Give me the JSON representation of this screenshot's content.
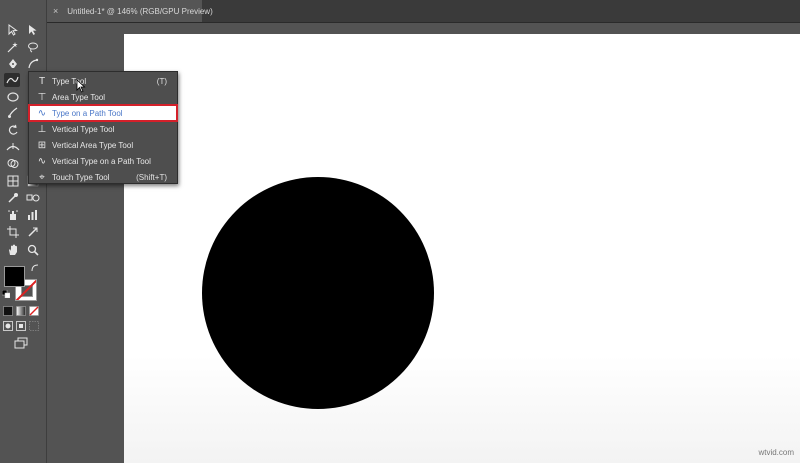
{
  "tab": {
    "close_glyph": "×",
    "title": "Untitled-1* @ 146% (RGB/GPU Preview)"
  },
  "toolbar": {
    "tools": [
      {
        "name": "selection-tool",
        "icon": "arrow-icon"
      },
      {
        "name": "direct-selection-tool",
        "icon": "hollow-arrow-icon"
      },
      {
        "name": "magic-wand-tool",
        "icon": "wand-icon"
      },
      {
        "name": "lasso-tool",
        "icon": "lasso-icon"
      },
      {
        "name": "pen-tool",
        "icon": "pen-icon"
      },
      {
        "name": "curvature-tool",
        "icon": "curvature-icon"
      },
      {
        "name": "type-tool",
        "icon": "type-path-icon"
      },
      {
        "name": "line-tool",
        "icon": "line-icon"
      },
      {
        "name": "ellipse-tool",
        "icon": "ellipse-icon"
      },
      {
        "name": "paintbrush-tool",
        "icon": "brush-icon"
      },
      {
        "name": "shaper-tool",
        "icon": "shaper-icon"
      },
      {
        "name": "eraser-tool",
        "icon": "eraser-icon"
      },
      {
        "name": "rotate-tool",
        "icon": "rotate-icon"
      },
      {
        "name": "scale-tool",
        "icon": "scale-icon"
      },
      {
        "name": "width-tool",
        "icon": "width-icon"
      },
      {
        "name": "free-transform-tool",
        "icon": "free-transform-icon"
      },
      {
        "name": "shape-builder-tool",
        "icon": "shape-builder-icon"
      },
      {
        "name": "perspective-grid-tool",
        "icon": "perspective-icon"
      },
      {
        "name": "mesh-tool",
        "icon": "mesh-icon"
      },
      {
        "name": "gradient-tool",
        "icon": "gradient-icon"
      },
      {
        "name": "eyedropper-tool",
        "icon": "eyedropper-icon"
      },
      {
        "name": "blend-tool",
        "icon": "blend-icon"
      },
      {
        "name": "symbol-sprayer-tool",
        "icon": "sprayer-icon"
      },
      {
        "name": "graph-tool",
        "icon": "graph-icon"
      },
      {
        "name": "artboard-tool",
        "icon": "artboard-icon"
      },
      {
        "name": "slice-tool",
        "icon": "slice-icon"
      },
      {
        "name": "hand-tool",
        "icon": "hand-icon"
      },
      {
        "name": "zoom-tool",
        "icon": "zoom-icon"
      }
    ],
    "fill_color": "#000000",
    "stroke_color": "#ffffff"
  },
  "flyout": {
    "items": [
      {
        "label": "Type Tool",
        "shortcut": "(T)",
        "icon": "T"
      },
      {
        "label": "Area Type Tool",
        "shortcut": "",
        "icon": "⊤"
      },
      {
        "label": "Type on a Path Tool",
        "shortcut": "",
        "icon": "∿"
      },
      {
        "label": "Vertical Type Tool",
        "shortcut": "",
        "icon": "⊥"
      },
      {
        "label": "Vertical Area Type Tool",
        "shortcut": "",
        "icon": "⊞"
      },
      {
        "label": "Vertical Type on a Path Tool",
        "shortcut": "",
        "icon": "∿"
      },
      {
        "label": "Touch Type Tool",
        "shortcut": "(Shift+T)",
        "icon": "⌖"
      }
    ],
    "highlighted_index": 2
  },
  "canvas": {
    "background": "#ffffff",
    "shape": "circle",
    "shape_fill": "#000000"
  },
  "watermark": "wtvid.com",
  "colors": {
    "highlight_outline": "#d4202a",
    "highlight_text": "#4a77c8"
  }
}
